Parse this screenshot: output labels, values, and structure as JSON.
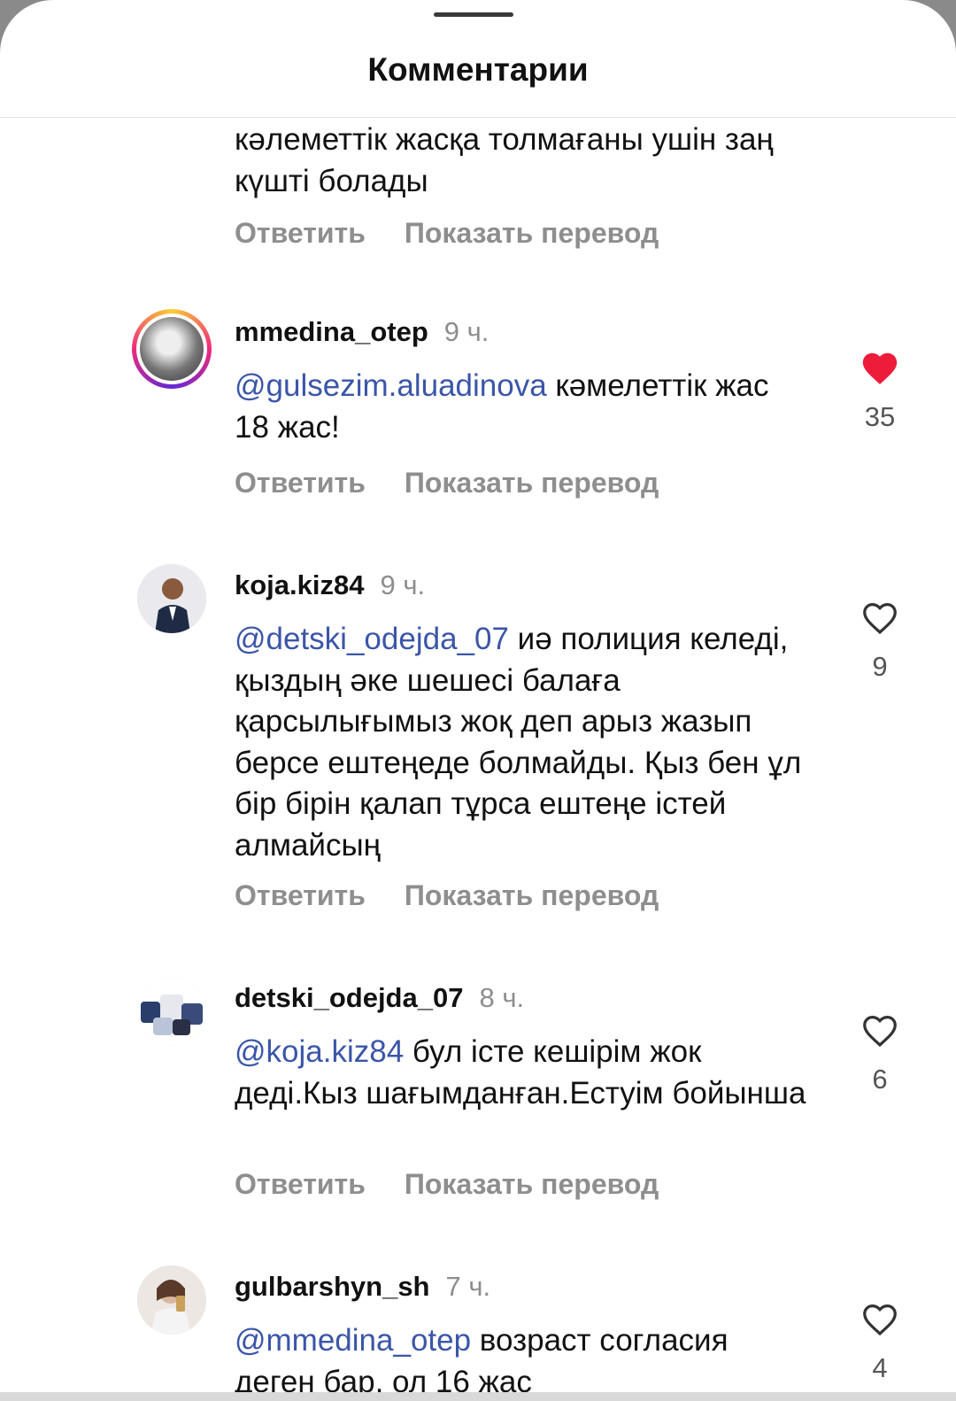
{
  "sheet": {
    "title": "Комментарии"
  },
  "actions": {
    "reply": "Ответить",
    "translate": "Показать перевод"
  },
  "comments": [
    {
      "text": "кәлеметтік жасқа толмағаны ушін заң күшті болады"
    },
    {
      "username": "mmedina_otep",
      "time": "9 ч.",
      "mention": "@gulsezim.aluadinova",
      "text": " кәмелеттік жас 18 жас!",
      "likes": "35",
      "liked": true
    },
    {
      "username": "koja.kiz84",
      "time": "9 ч.",
      "mention": "@detski_odejda_07",
      "text": " иә полиция келеді, қыздың әке шешесі балаға қарсылығымыз жоқ деп арыз жазып берсе ештеңеде болмайды. Қыз бен ұл бір бірін қалап тұрса ештеңе істей алмайсың",
      "likes": "9",
      "liked": false
    },
    {
      "username": "detski_odejda_07",
      "time": "8 ч.",
      "mention": "@koja.kiz84",
      "text": " бул істе кешірім жок деді.Кыз шағымданған.Естуім бойынша",
      "likes": "6",
      "liked": false
    },
    {
      "username": "gulbarshyn_sh",
      "time": "7 ч.",
      "mention": "@mmedina_otep",
      "text": " возраст согласия деген бар, ол 16 жас",
      "likes": "4",
      "liked": false
    }
  ],
  "colors": {
    "mention": "#3b55a8",
    "like_red": "#ed1c3a",
    "muted": "#8e8e8e"
  }
}
